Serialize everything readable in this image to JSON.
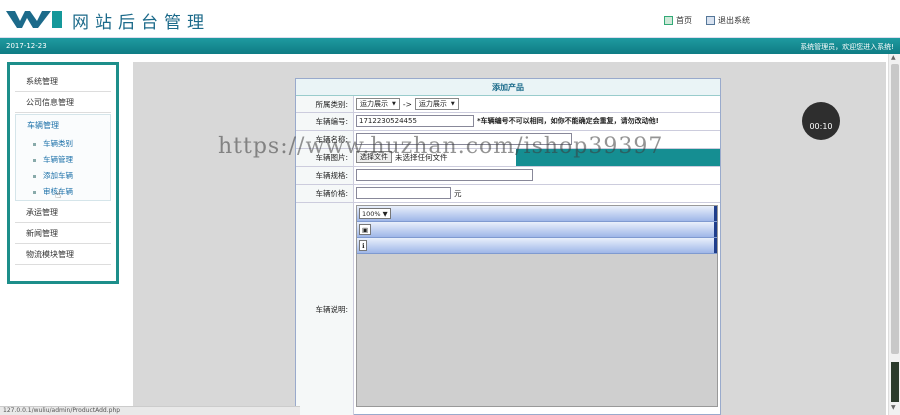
{
  "header": {
    "title": "网站后台管理",
    "home_label": "首页",
    "logout_label": "退出系统"
  },
  "status": {
    "date": "2017-12-23",
    "welcome": "系统管理员，欢迎您进入系统!"
  },
  "sidebar": {
    "items": [
      {
        "label": "系统管理"
      },
      {
        "label": "公司信息管理"
      },
      {
        "label": "车辆管理"
      },
      {
        "label": "承运管理"
      },
      {
        "label": "新闻管理"
      },
      {
        "label": "物流模块管理"
      }
    ],
    "subitems": [
      {
        "label": "车辆类别"
      },
      {
        "label": "车辆管理"
      },
      {
        "label": "添加车辆"
      },
      {
        "label": "审核车辆"
      }
    ]
  },
  "form": {
    "title": "添加产品",
    "category_label": "所属类别:",
    "category_select1": "运力展示",
    "category_arrow": "->",
    "category_select2": "运力展示",
    "number_label": "车辆编号:",
    "number_value": "1712230524455",
    "number_warning": "*车辆编号不可以相同，如你不能确定会重复，请勿改动他!",
    "name_label": "车辆名称:",
    "image_label": "车辆图片:",
    "file_button": "选择文件",
    "file_status": "未选择任何文件",
    "spec_label": "车辆规格:",
    "price_label": "车辆价格:",
    "price_unit": "元",
    "desc_label": "车辆说明:",
    "editor_zoom": "100%",
    "editor_icon1": "image-tool",
    "editor_icon2": "info-tool"
  },
  "overlay": {
    "watermark": "https://www.huzhan.com/ishop39397",
    "recording_time": "00:10",
    "url": "127.0.0.1/wuliu/admin/ProductAdd.php"
  }
}
